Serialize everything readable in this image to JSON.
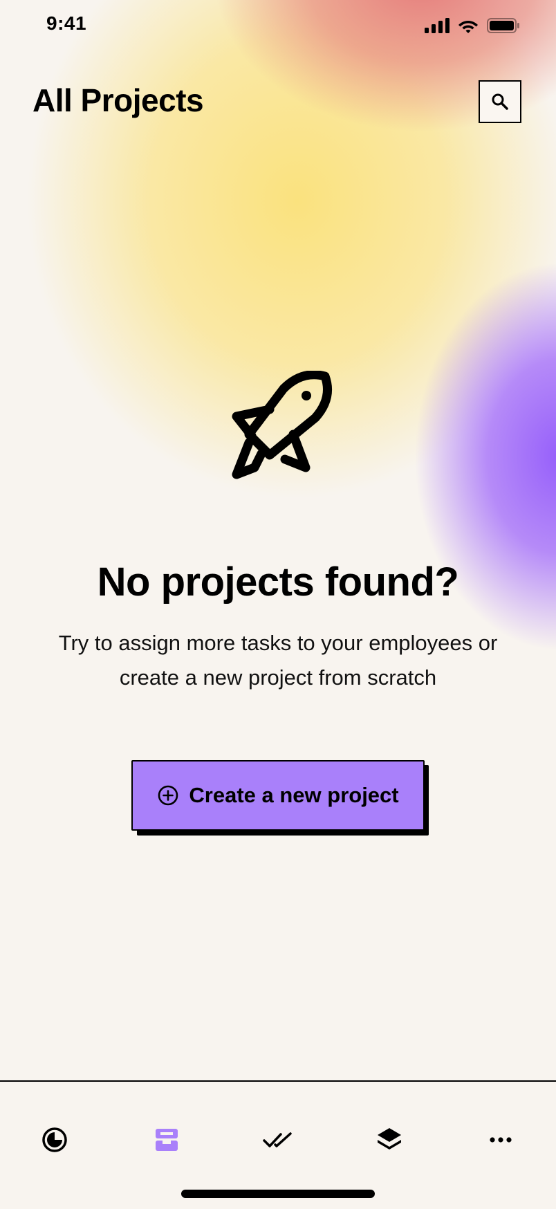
{
  "status_bar": {
    "time": "9:41",
    "icons": [
      "signal-icon",
      "wifi-icon",
      "battery-icon"
    ]
  },
  "header": {
    "title": "All Projects",
    "search_icon": "search-icon"
  },
  "empty_state": {
    "illustration": "rocket-icon",
    "title": "No projects found?",
    "description": "Try to assign more tasks to your employees or create a new project from scratch",
    "create_button": {
      "icon": "plus-circle-icon",
      "label": "Create a new project"
    }
  },
  "tab_bar": {
    "tabs": [
      {
        "icon": "dashboard-icon",
        "active": false
      },
      {
        "icon": "inbox-icon",
        "active": true
      },
      {
        "icon": "double-check-icon",
        "active": false
      },
      {
        "icon": "layers-icon",
        "active": false
      },
      {
        "icon": "more-icon",
        "active": false
      }
    ]
  },
  "colors": {
    "background": "#f8f4ef",
    "accent": "#a980fa",
    "blob_yellow": "#f8e38c",
    "blob_red": "#e47a76",
    "blob_purple": "#965ffa"
  }
}
